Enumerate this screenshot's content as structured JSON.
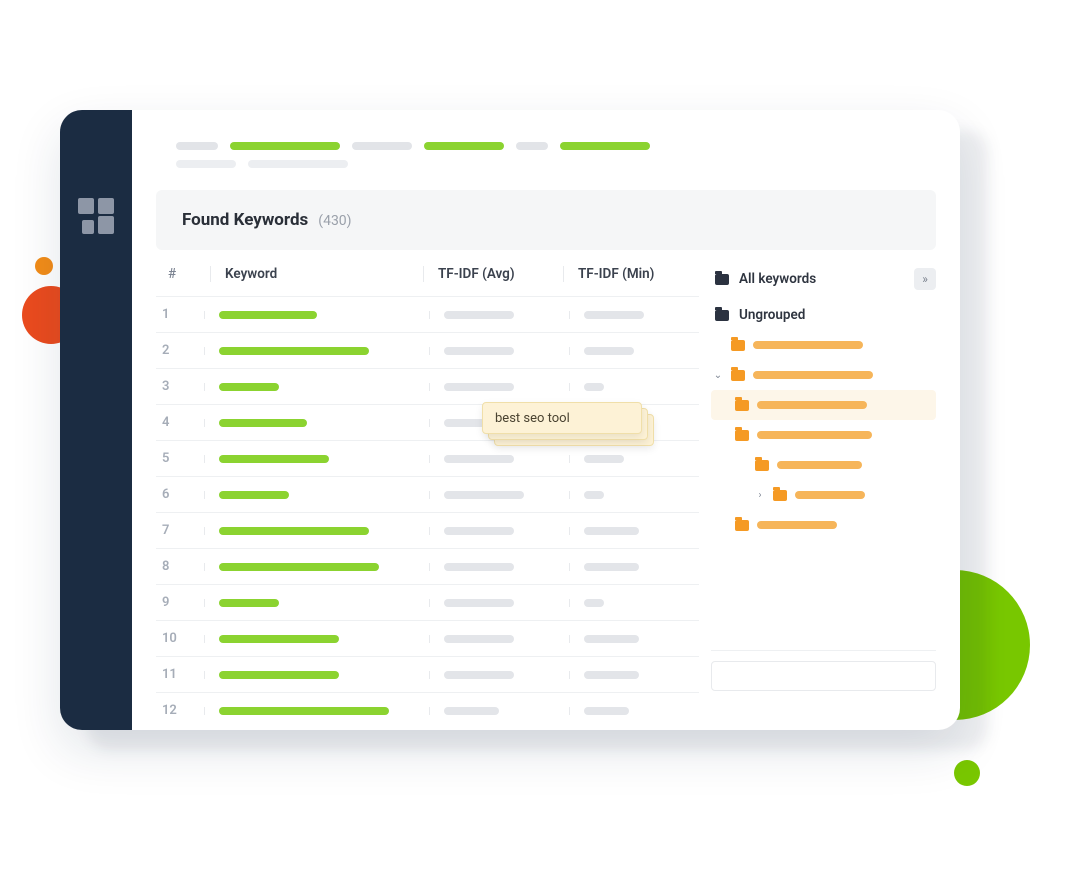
{
  "panel": {
    "title": "Found Keywords",
    "count": "(430)"
  },
  "table": {
    "headers": {
      "num": "#",
      "keyword": "Keyword",
      "avg": "TF-IDF (Avg)",
      "min": "TF-IDF (Min)"
    },
    "rows": [
      {
        "n": "1",
        "kw": 98,
        "avg": 70,
        "min": 60
      },
      {
        "n": "2",
        "kw": 150,
        "avg": 70,
        "min": 50
      },
      {
        "n": "3",
        "kw": 60,
        "avg": 70,
        "min": 20
      },
      {
        "n": "4",
        "kw": 88,
        "avg": 90,
        "min": 55
      },
      {
        "n": "5",
        "kw": 110,
        "avg": 70,
        "min": 40
      },
      {
        "n": "6",
        "kw": 70,
        "avg": 80,
        "min": 20
      },
      {
        "n": "7",
        "kw": 150,
        "avg": 70,
        "min": 55
      },
      {
        "n": "8",
        "kw": 160,
        "avg": 70,
        "min": 55
      },
      {
        "n": "9",
        "kw": 60,
        "avg": 70,
        "min": 20
      },
      {
        "n": "10",
        "kw": 120,
        "avg": 70,
        "min": 55
      },
      {
        "n": "11",
        "kw": 120,
        "avg": 70,
        "min": 55
      },
      {
        "n": "12",
        "kw": 170,
        "avg": 55,
        "min": 45
      }
    ]
  },
  "sidepanel": {
    "all": "All keywords",
    "ungrouped": "Ungrouped",
    "collapse_glyph": "»"
  },
  "tooltip": {
    "text": "best seo tool"
  }
}
